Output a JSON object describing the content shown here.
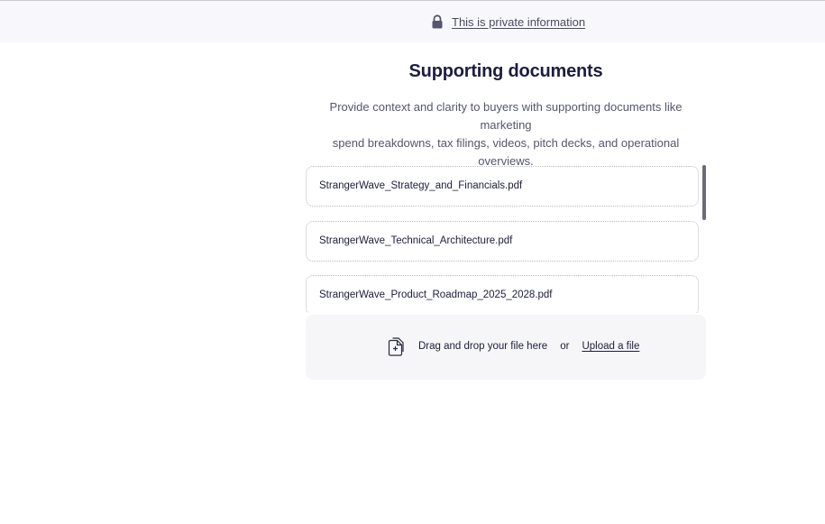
{
  "private_bar": {
    "icon": "lock-icon",
    "text": "This is private information"
  },
  "section": {
    "title": "Supporting documents",
    "description_line1": "Provide context and clarity to buyers with supporting documents like marketing",
    "description_line2": "spend breakdowns, tax filings, videos, pitch decks, and operational overviews."
  },
  "files": [
    {
      "name": "StrangerWave_Strategy_and_Financials.pdf"
    },
    {
      "name": "StrangerWave_Technical_Architecture.pdf"
    },
    {
      "name": "StrangerWave_Product_Roadmap_2025_2028.pdf"
    }
  ],
  "dropzone": {
    "icon": "file-add-icon",
    "text": "Drag and drop your file here",
    "or": "or",
    "upload_label": "Upload a file"
  },
  "colors": {
    "accent": "#1d1d3d",
    "muted_text": "#55556e",
    "bar_bg": "#f8f8fc",
    "dropzone_bg": "#f6f6f9"
  }
}
